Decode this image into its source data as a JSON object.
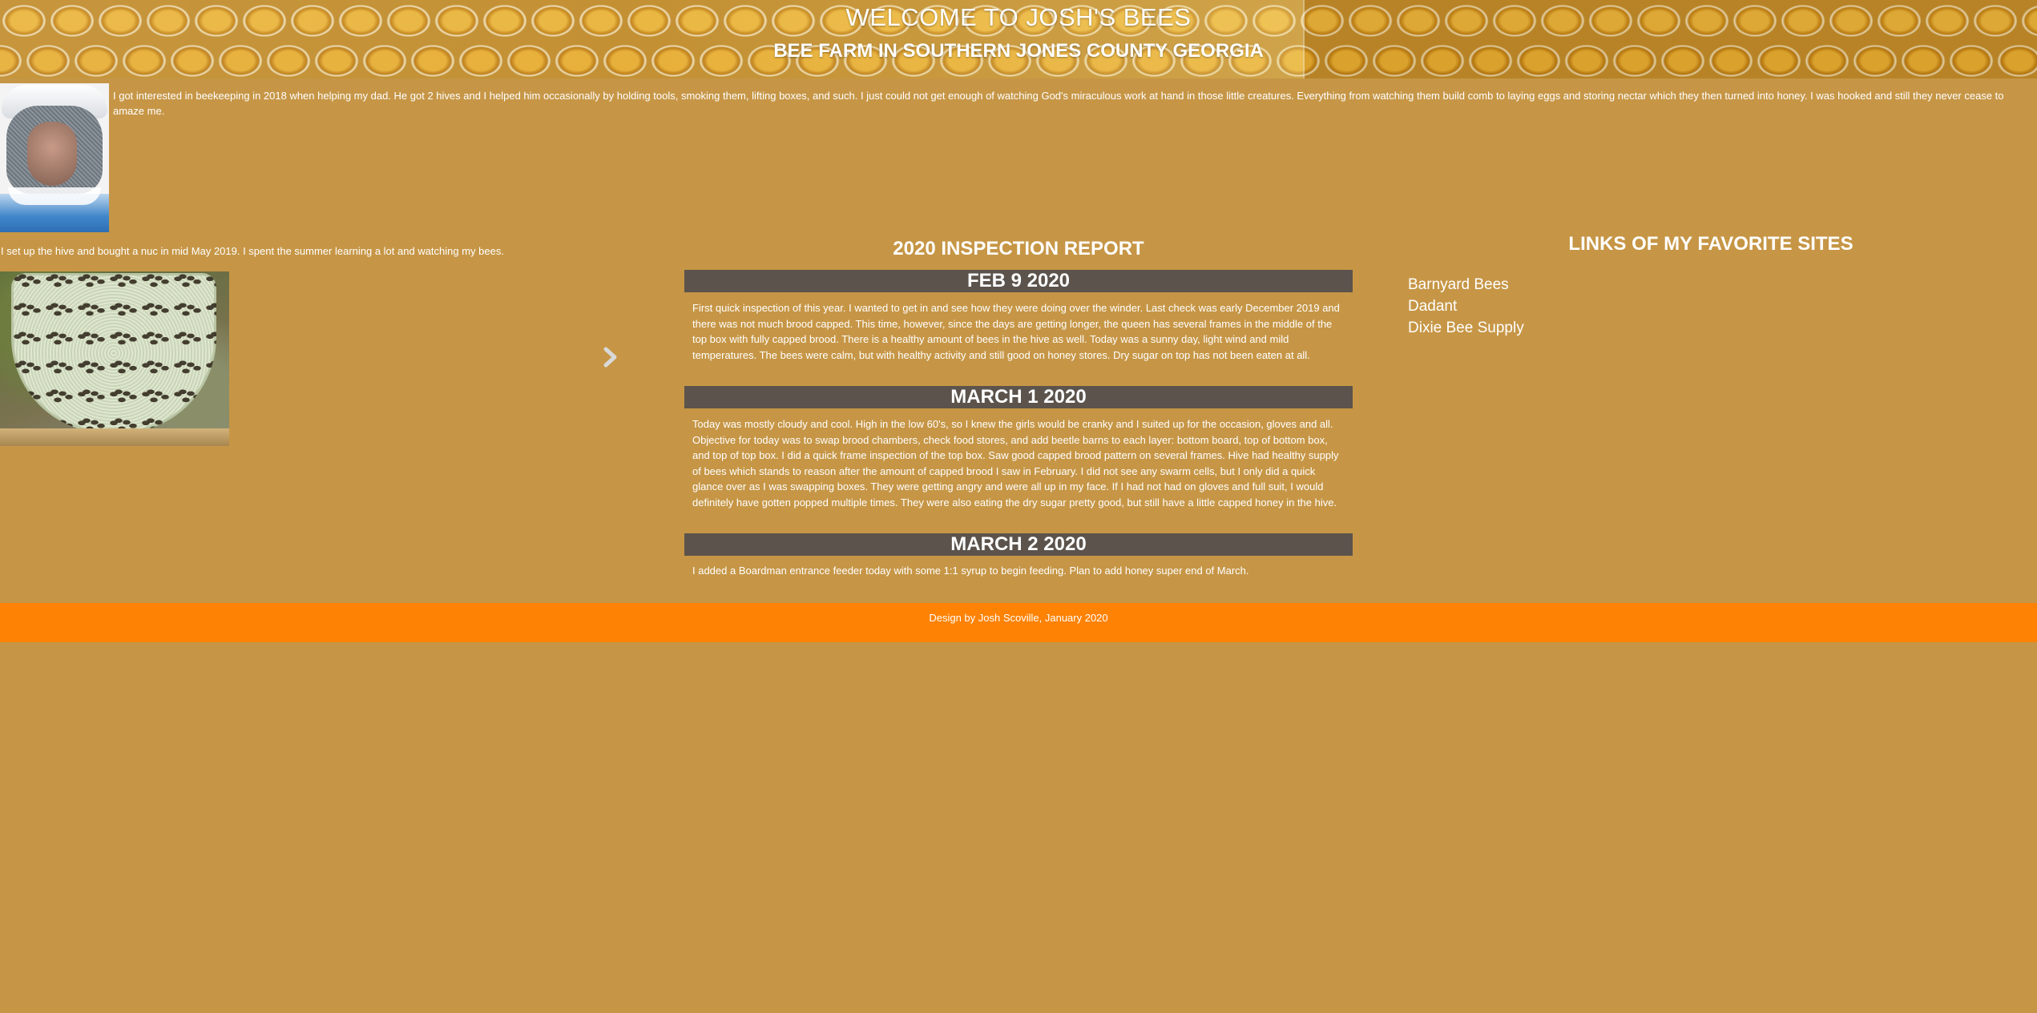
{
  "header": {
    "title": "WELCOME TO JOSH'S BEES",
    "subtitle": "BEE FARM IN SOUTHERN JONES COUNTY GEORGIA"
  },
  "intro": {
    "text": "I got interested in beekeeping in 2018 when helping my dad. He got 2 hives and I helped him occasionally by holding tools, smoking them, lifting boxes, and such. I just could not get enough of watching God's miraculous work at hand in those little creatures. Everything from watching them build comb to laying eggs and storing nectar which they then turned into honey. I was hooked and still they never cease to amaze me.",
    "hive_text": "I set up the hive and bought a nuc in mid May 2019. I spent the summer learning a lot and watching my bees."
  },
  "report": {
    "title": "2020 INSPECTION REPORT",
    "entries": [
      {
        "date": "FEB 9 2020",
        "text": "First quick inspection of this year. I wanted to get in and see how they were doing over the winder. Last check was early December 2019 and there was not much brood capped. This time, however, since the days are getting longer, the queen has several frames in the middle of the top box with fully capped brood. There is a healthy amount of bees in the hive as well. Today was a sunny day, light wind and mild temperatures. The bees were calm, but with healthy activity and still good on honey stores. Dry sugar on top has not been eaten at all."
      },
      {
        "date": "MARCH 1 2020",
        "text": "Today was mostly cloudy and cool. High in the low 60's, so I knew the girls would be cranky and I suited up for the occasion, gloves and all. Objective for today was to swap brood chambers, check food stores, and add beetle barns to each layer: bottom board, top of bottom box, and top of top box. I did a quick frame inspection of the top box. Saw good capped brood pattern on several frames. Hive had healthy supply of bees which stands to reason after the amount of capped brood I saw in February. I did not see any swarm cells, but I only did a quick glance over as I was swapping boxes. They were getting angry and were all up in my face. If I had not had on gloves and full suit, I would definitely have gotten popped multiple times. They were also eating the dry sugar pretty good, but still have a little capped honey in the hive."
      },
      {
        "date": "MARCH 2 2020",
        "text": "I added a Boardman entrance feeder today with some 1:1 syrup to begin feeding. Plan to add honey super end of March."
      }
    ]
  },
  "links": {
    "title": "LINKS OF MY FAVORITE SITES",
    "items": [
      "Barnyard Bees",
      "Dadant",
      "Dixie Bee Supply"
    ]
  },
  "footer": {
    "text": "Design by Josh Scoville, January 2020"
  },
  "icons": {
    "next": "chevron-right-icon"
  },
  "colors": {
    "page_background": "#c69646",
    "entry_bar": "#5b534c",
    "footer": "#fe8204"
  }
}
